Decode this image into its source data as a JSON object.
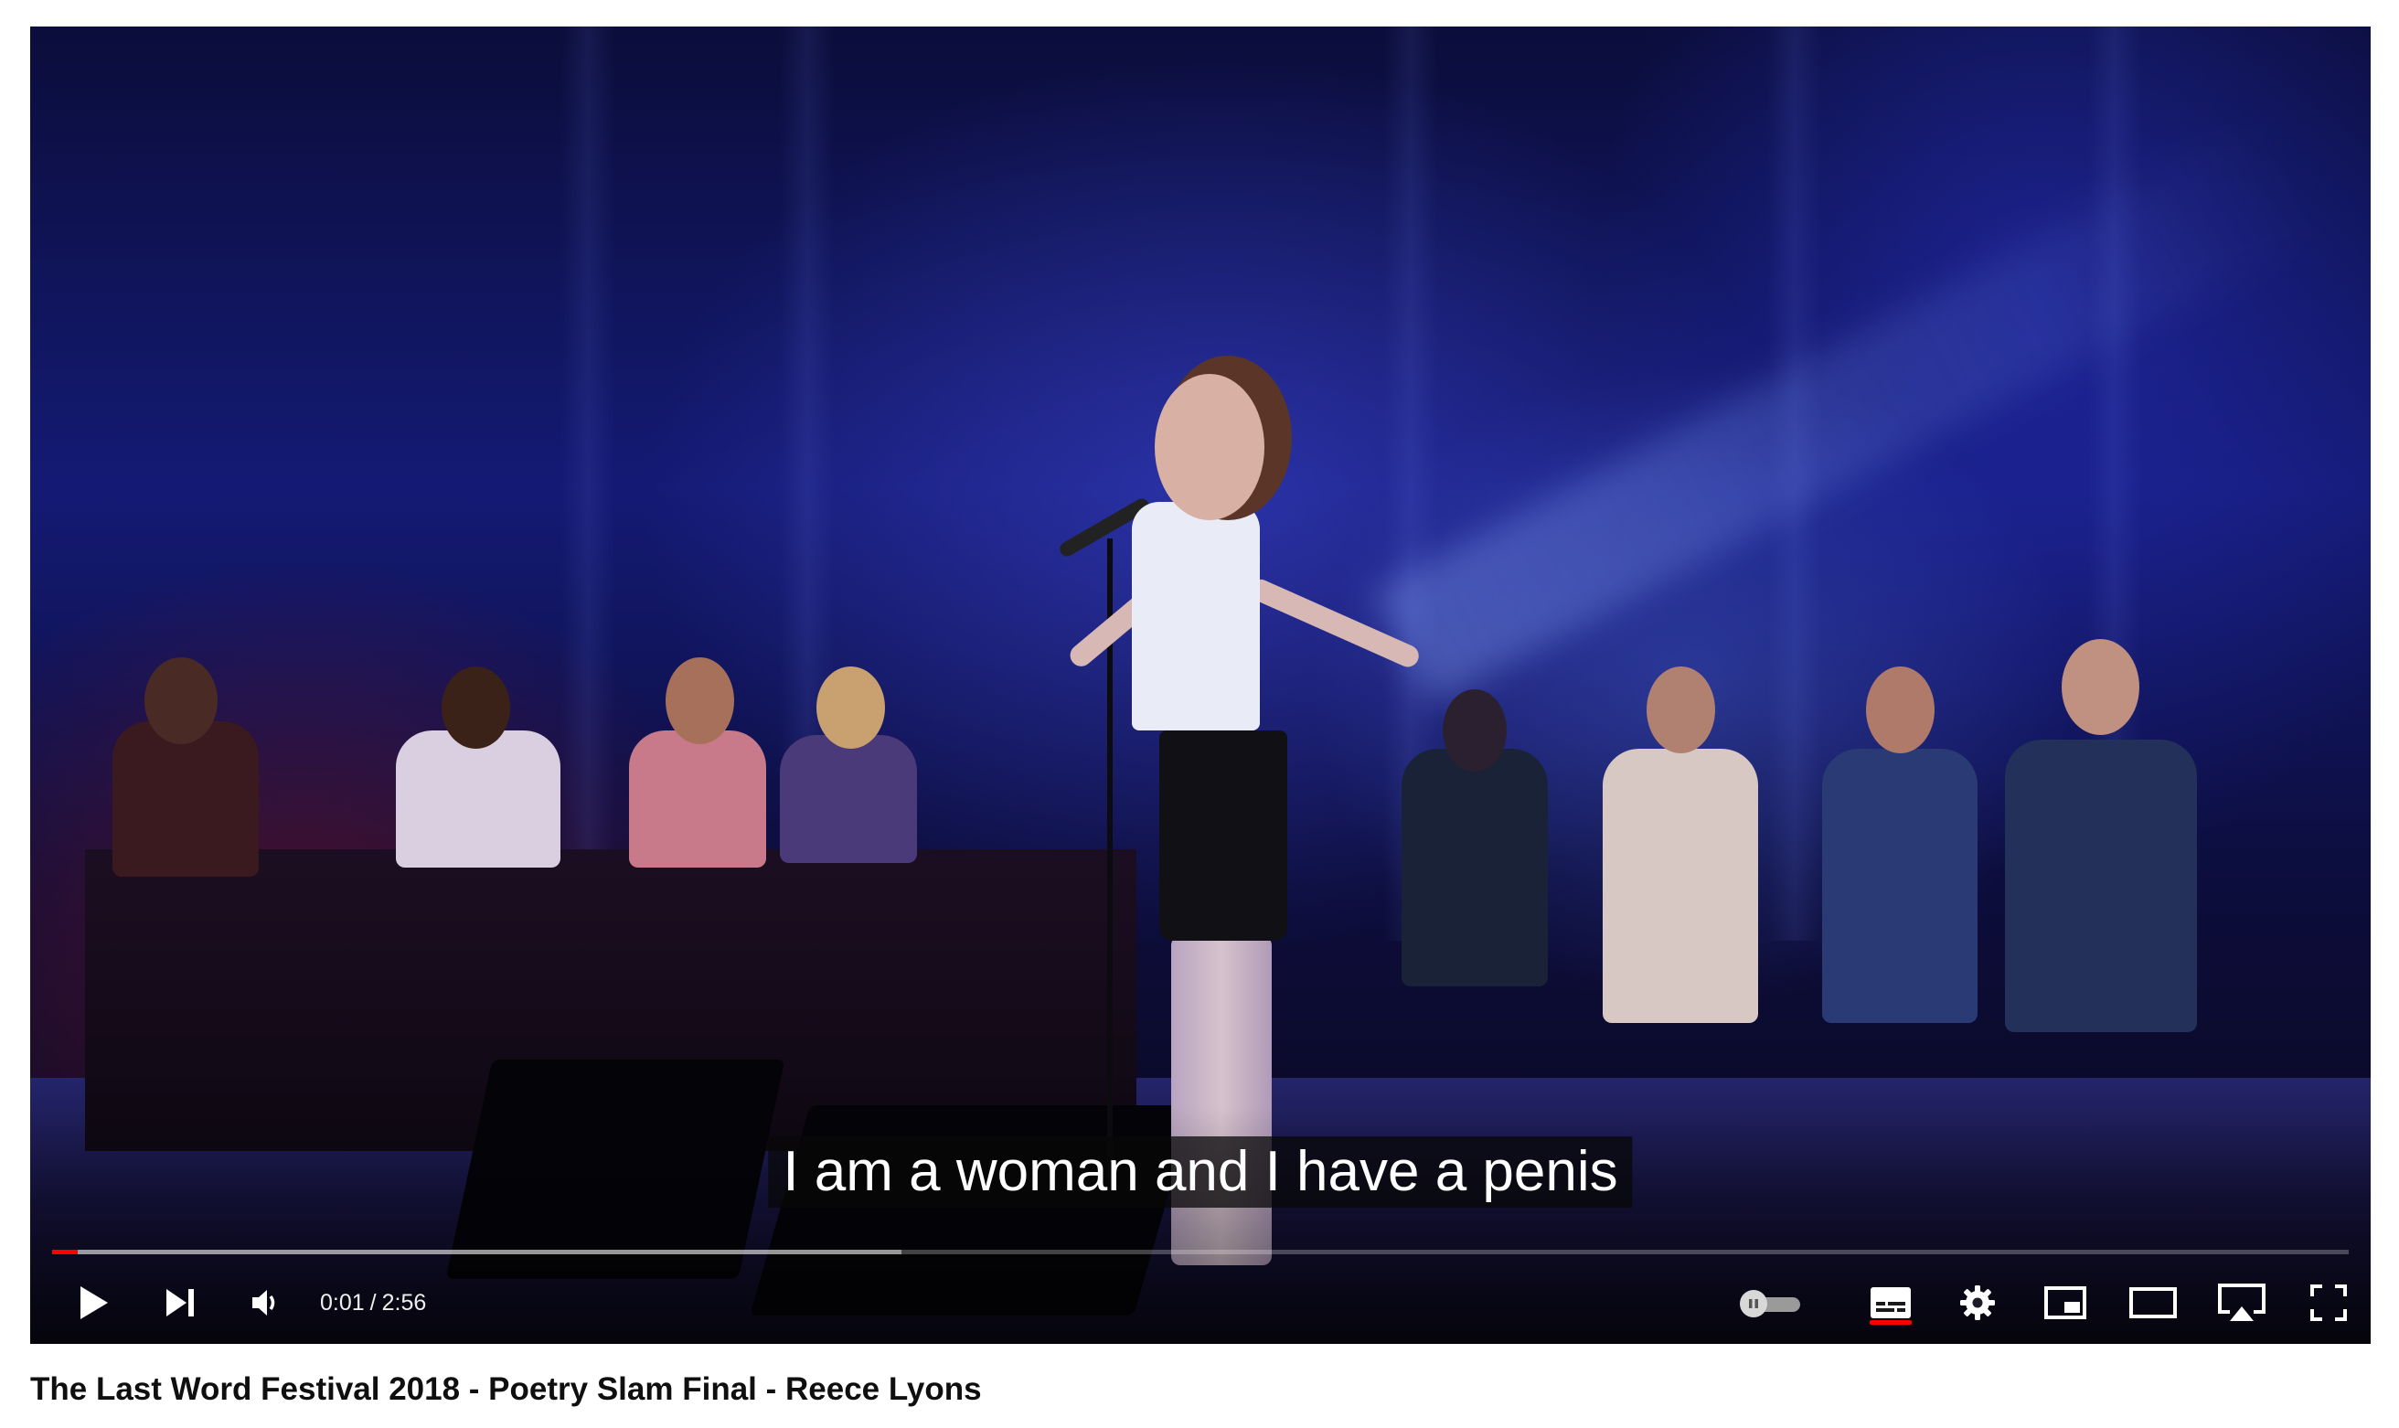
{
  "player": {
    "subtitle": "I am a woman and I have a penis",
    "progress": {
      "played_fraction": 0.011,
      "buffered_fraction": 0.37
    },
    "time": {
      "current": "0:01",
      "separator": "/",
      "duration": "2:56"
    },
    "controls": {
      "play": "play-icon",
      "next": "next-icon",
      "volume": "volume-icon",
      "autoplay": "autoplay-toggle",
      "captions": "captions-icon",
      "settings": "gear-icon",
      "miniplayer": "miniplayer-icon",
      "theater": "theater-mode-icon",
      "airplay": "airplay-icon",
      "fullscreen": "fullscreen-icon"
    },
    "colors": {
      "progress_played": "#ff0000",
      "captions_active": "#ff0000"
    }
  },
  "video": {
    "title": "The Last Word Festival 2018 - Poetry Slam Final - Reece Lyons"
  }
}
